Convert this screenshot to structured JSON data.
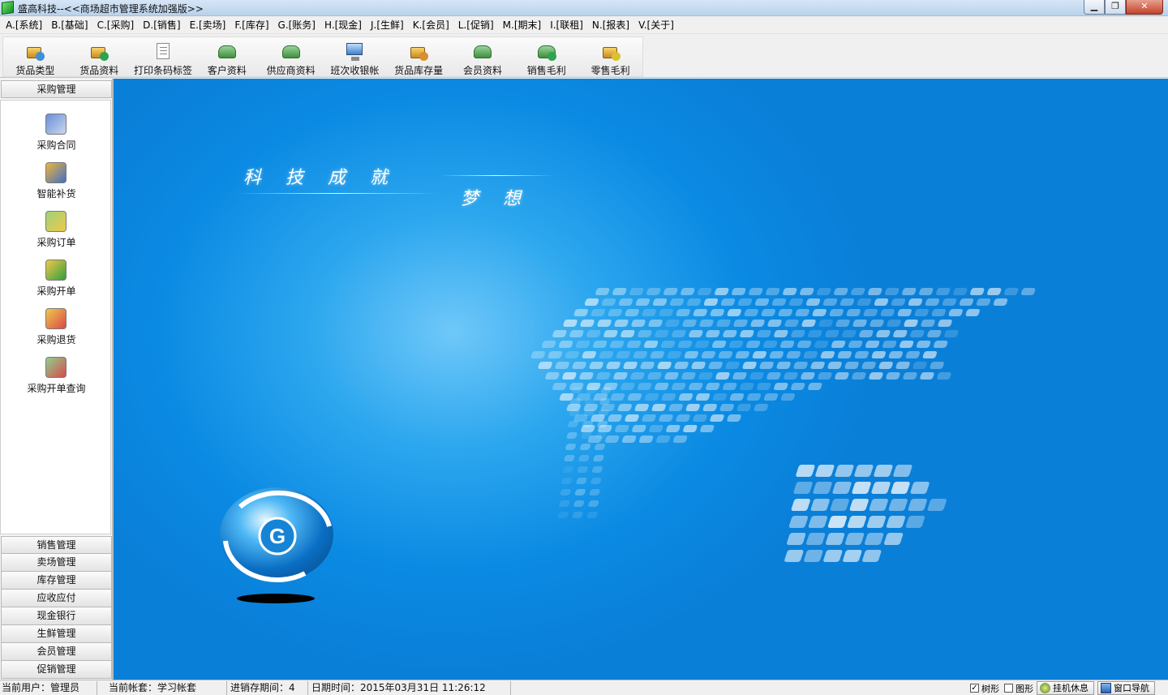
{
  "window": {
    "title": "盛高科技--<<商场超市管理系统加强版>>",
    "controls": {
      "minimize": "▁",
      "maximize": "❐",
      "close": "✕"
    }
  },
  "menu": [
    "A.[系统]",
    "B.[基础]",
    "C.[采购]",
    "D.[销售]",
    "E.[卖场]",
    "F.[库存]",
    "G.[账务]",
    "H.[现金]",
    "J.[生鲜]",
    "K.[会员]",
    "L.[促销]",
    "M.[期末]",
    "I.[联租]",
    "N.[报表]",
    "V.[关于]"
  ],
  "toolbar": [
    {
      "label": "货品类型",
      "icon": "product-type-icon"
    },
    {
      "label": "货品资料",
      "icon": "product-data-icon"
    },
    {
      "label": "打印条码标签",
      "icon": "print-barcode-icon"
    },
    {
      "label": "客户资料",
      "icon": "customer-icon"
    },
    {
      "label": "供应商资料",
      "icon": "supplier-icon"
    },
    {
      "label": "班次收银帐",
      "icon": "cashier-shift-icon"
    },
    {
      "label": "货品库存量",
      "icon": "stock-icon"
    },
    {
      "label": "会员资料",
      "icon": "member-icon"
    },
    {
      "label": "销售毛利",
      "icon": "sales-profit-icon"
    },
    {
      "label": "零售毛利",
      "icon": "retail-profit-icon"
    }
  ],
  "left_panel": {
    "active_section": "采购管理",
    "items": [
      {
        "label": "采购合同",
        "icon": "purchase-contract-icon"
      },
      {
        "label": "智能补货",
        "icon": "smart-restock-icon"
      },
      {
        "label": "采购订单",
        "icon": "purchase-order-icon"
      },
      {
        "label": "采购开单",
        "icon": "purchase-billing-icon"
      },
      {
        "label": "采购退货",
        "icon": "purchase-return-icon"
      },
      {
        "label": "采购开单查询",
        "icon": "purchase-query-icon"
      }
    ],
    "sections": [
      "销售管理",
      "卖场管理",
      "库存管理",
      "应收应付",
      "现金银行",
      "生鲜管理",
      "会员管理",
      "促销管理"
    ]
  },
  "main": {
    "slogan_top": "科技成就",
    "slogan_bottom": "梦想",
    "logo_letter": "G"
  },
  "status": {
    "user": "当前用户：管理员",
    "account": "当前帐套：学习帐套",
    "period": "进销存期间：4",
    "datetime": "日期时间：2015年03月31日 11:26:12",
    "tree_label": "树形",
    "tree_checked": true,
    "graphic_label": "图形",
    "graphic_checked": false,
    "standby_button": "挂机休息",
    "nav_button": "窗口导航"
  },
  "colors": {
    "background_blue": "#0b8ae3",
    "glow_blue": "#6fc8f9"
  }
}
